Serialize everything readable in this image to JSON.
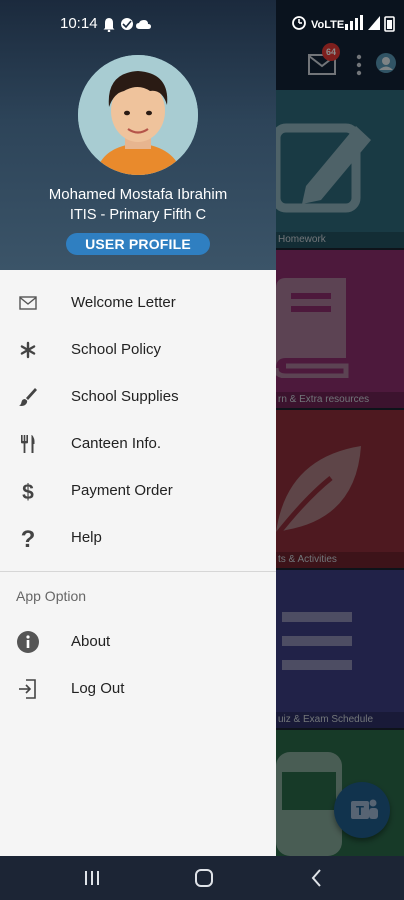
{
  "status_bar": {
    "time": "10:14"
  },
  "background_app": {
    "mail_badge": "64",
    "tiles": [
      {
        "label": "Homework",
        "icon": "pencil-icon"
      },
      {
        "label": "rn & Extra resources",
        "icon": "book-icon"
      },
      {
        "label": "ts & Activities",
        "icon": "leaf-icon"
      },
      {
        "label": "uiz & Exam Schedule",
        "icon": "list-icon"
      },
      {
        "label": "",
        "icon": "bus-icon"
      }
    ]
  },
  "drawer": {
    "user_name": "Mohamed Mostafa Ibrahim",
    "user_class": "ITIS - Primary Fifth C",
    "profile_button": "USER PROFILE",
    "menu_items": [
      {
        "label": "Welcome Letter",
        "icon": "envelope-icon"
      },
      {
        "label": "School Policy",
        "icon": "asterisk-icon"
      },
      {
        "label": "School Supplies",
        "icon": "brush-icon"
      },
      {
        "label": "Canteen Info.",
        "icon": "cutlery-icon"
      },
      {
        "label": "Payment Order",
        "icon": "dollar-icon"
      },
      {
        "label": "Help",
        "icon": "question-icon"
      }
    ],
    "section_title": "App Option",
    "option_items": [
      {
        "label": "About",
        "icon": "info-icon"
      },
      {
        "label": "Log Out",
        "icon": "logout-icon"
      }
    ]
  },
  "colors": {
    "header_gradient_top": "#1b2a3d",
    "profile_button": "#2f7fc1",
    "badge": "#e53935"
  }
}
